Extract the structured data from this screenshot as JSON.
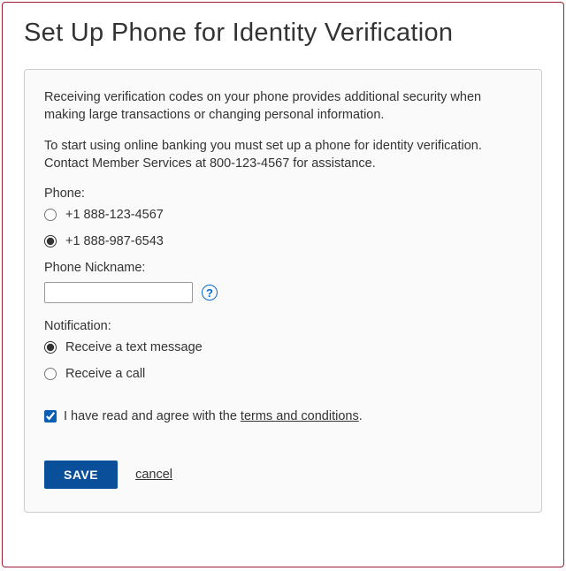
{
  "title": "Set Up Phone for Identity Verification",
  "intro1": "Receiving verification codes on your phone provides additional security when making large transactions or changing personal information.",
  "intro2": "To start using online banking you must set up a phone for identity verification. Contact Member Services at 800-123-4567 for assistance.",
  "phone": {
    "label": "Phone:",
    "options": [
      {
        "text": "+1 888-123-4567",
        "selected": false
      },
      {
        "text": "+1 888-987-6543",
        "selected": true
      }
    ]
  },
  "nickname": {
    "label": "Phone Nickname:",
    "value": "",
    "help": "?"
  },
  "notification": {
    "label": "Notification:",
    "options": [
      {
        "text": "Receive a text message",
        "selected": true
      },
      {
        "text": "Receive a call",
        "selected": false
      }
    ]
  },
  "terms": {
    "prefix": "I have read and agree with the ",
    "link": "terms and conditions",
    "suffix": ".",
    "checked": true
  },
  "actions": {
    "save": "SAVE",
    "cancel": "cancel"
  }
}
